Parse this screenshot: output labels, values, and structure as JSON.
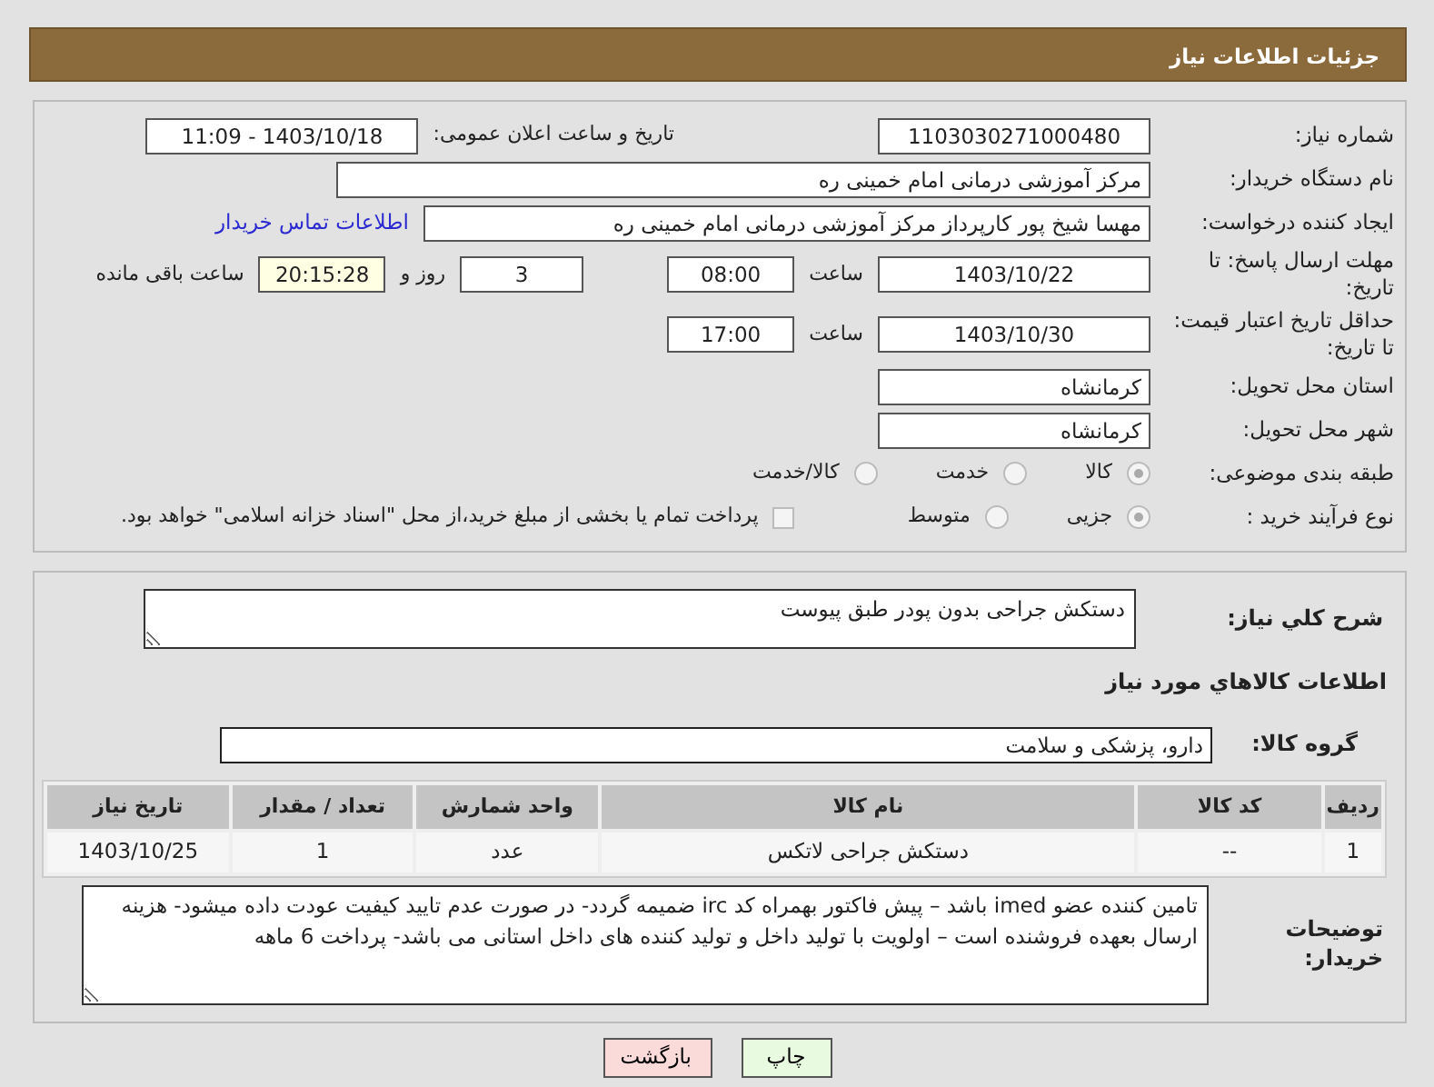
{
  "header": {
    "title": "جزئیات اطلاعات نیاز"
  },
  "details": {
    "need_number": {
      "label": "شماره نیاز:",
      "value": "1103030271000480"
    },
    "announce": {
      "label": "تاریخ و ساعت اعلان عمومی:",
      "value": "1403/10/18 - 11:09"
    },
    "buyer": {
      "label": "نام دستگاه خریدار:",
      "value": "مرکز آموزشی درمانی امام خمینی ره"
    },
    "creator": {
      "label": "ایجاد کننده درخواست:",
      "value": "مهسا شیخ پور کارپرداز مرکز آموزشی درمانی امام خمینی ره",
      "link": "اطلاعات تماس خریدار"
    },
    "deadline": {
      "label": "مهلت ارسال پاسخ: تا تاریخ:",
      "date": "1403/10/22",
      "time_label": "ساعت",
      "time": "08:00",
      "days": "3",
      "days_label": "روز و",
      "remaining": "20:15:28",
      "remaining_label": "ساعت باقی مانده"
    },
    "validity": {
      "label": "حداقل تاریخ اعتبار قیمت: تا تاریخ:",
      "date": "1403/10/30",
      "time_label": "ساعت",
      "time": "17:00"
    },
    "province": {
      "label": "استان محل تحویل:",
      "value": "کرمانشاه"
    },
    "city": {
      "label": "شهر محل تحویل:",
      "value": "کرمانشاه"
    },
    "category": {
      "label": "طبقه بندی موضوعی:",
      "options": [
        {
          "label": "کالا",
          "selected": true
        },
        {
          "label": "خدمت",
          "selected": false
        },
        {
          "label": "کالا/خدمت",
          "selected": false
        }
      ]
    },
    "process": {
      "label": "نوع فرآیند خرید :",
      "options": [
        {
          "label": "جزیی",
          "selected": true
        },
        {
          "label": "متوسط",
          "selected": false
        }
      ],
      "treasury": {
        "label": "پرداخت تمام یا بخشی از مبلغ خرید،از محل \"اسناد خزانه اسلامی\" خواهد بود.",
        "checked": false
      }
    }
  },
  "needs": {
    "summary": {
      "label": "شرح کلي نیاز:",
      "value": "دستکش جراحی بدون پودر طبق پیوست"
    },
    "goods_heading": "اطلاعات کالاهاي مورد نیاز",
    "group": {
      "label": "گروه کالا:",
      "value": "دارو، پزشکی و سلامت"
    },
    "table": {
      "columns": [
        "ردیف",
        "کد کالا",
        "نام کالا",
        "واحد شمارش",
        "تعداد / مقدار",
        "تاریخ نیاز"
      ],
      "rows": [
        [
          "1",
          "--",
          "دستکش جراحی لاتکس",
          "عدد",
          "1",
          "1403/10/25"
        ]
      ]
    },
    "notes": {
      "label": "توضیحات خریدار:",
      "value": "تامین کننده عضو imed باشد – پیش فاکتور بهمراه کد irc ضمیمه گردد- در صورت عدم تایید کیفیت عودت داده میشود- هزینه ارسال بعهده فروشنده است – اولویت با تولید داخل و تولید کننده های داخل استانی می باشد- پرداخت 6 ماهه"
    }
  },
  "buttons": [
    {
      "label": "چاپ",
      "kind": "print"
    },
    {
      "label": "بازگشت",
      "kind": "back"
    }
  ]
}
